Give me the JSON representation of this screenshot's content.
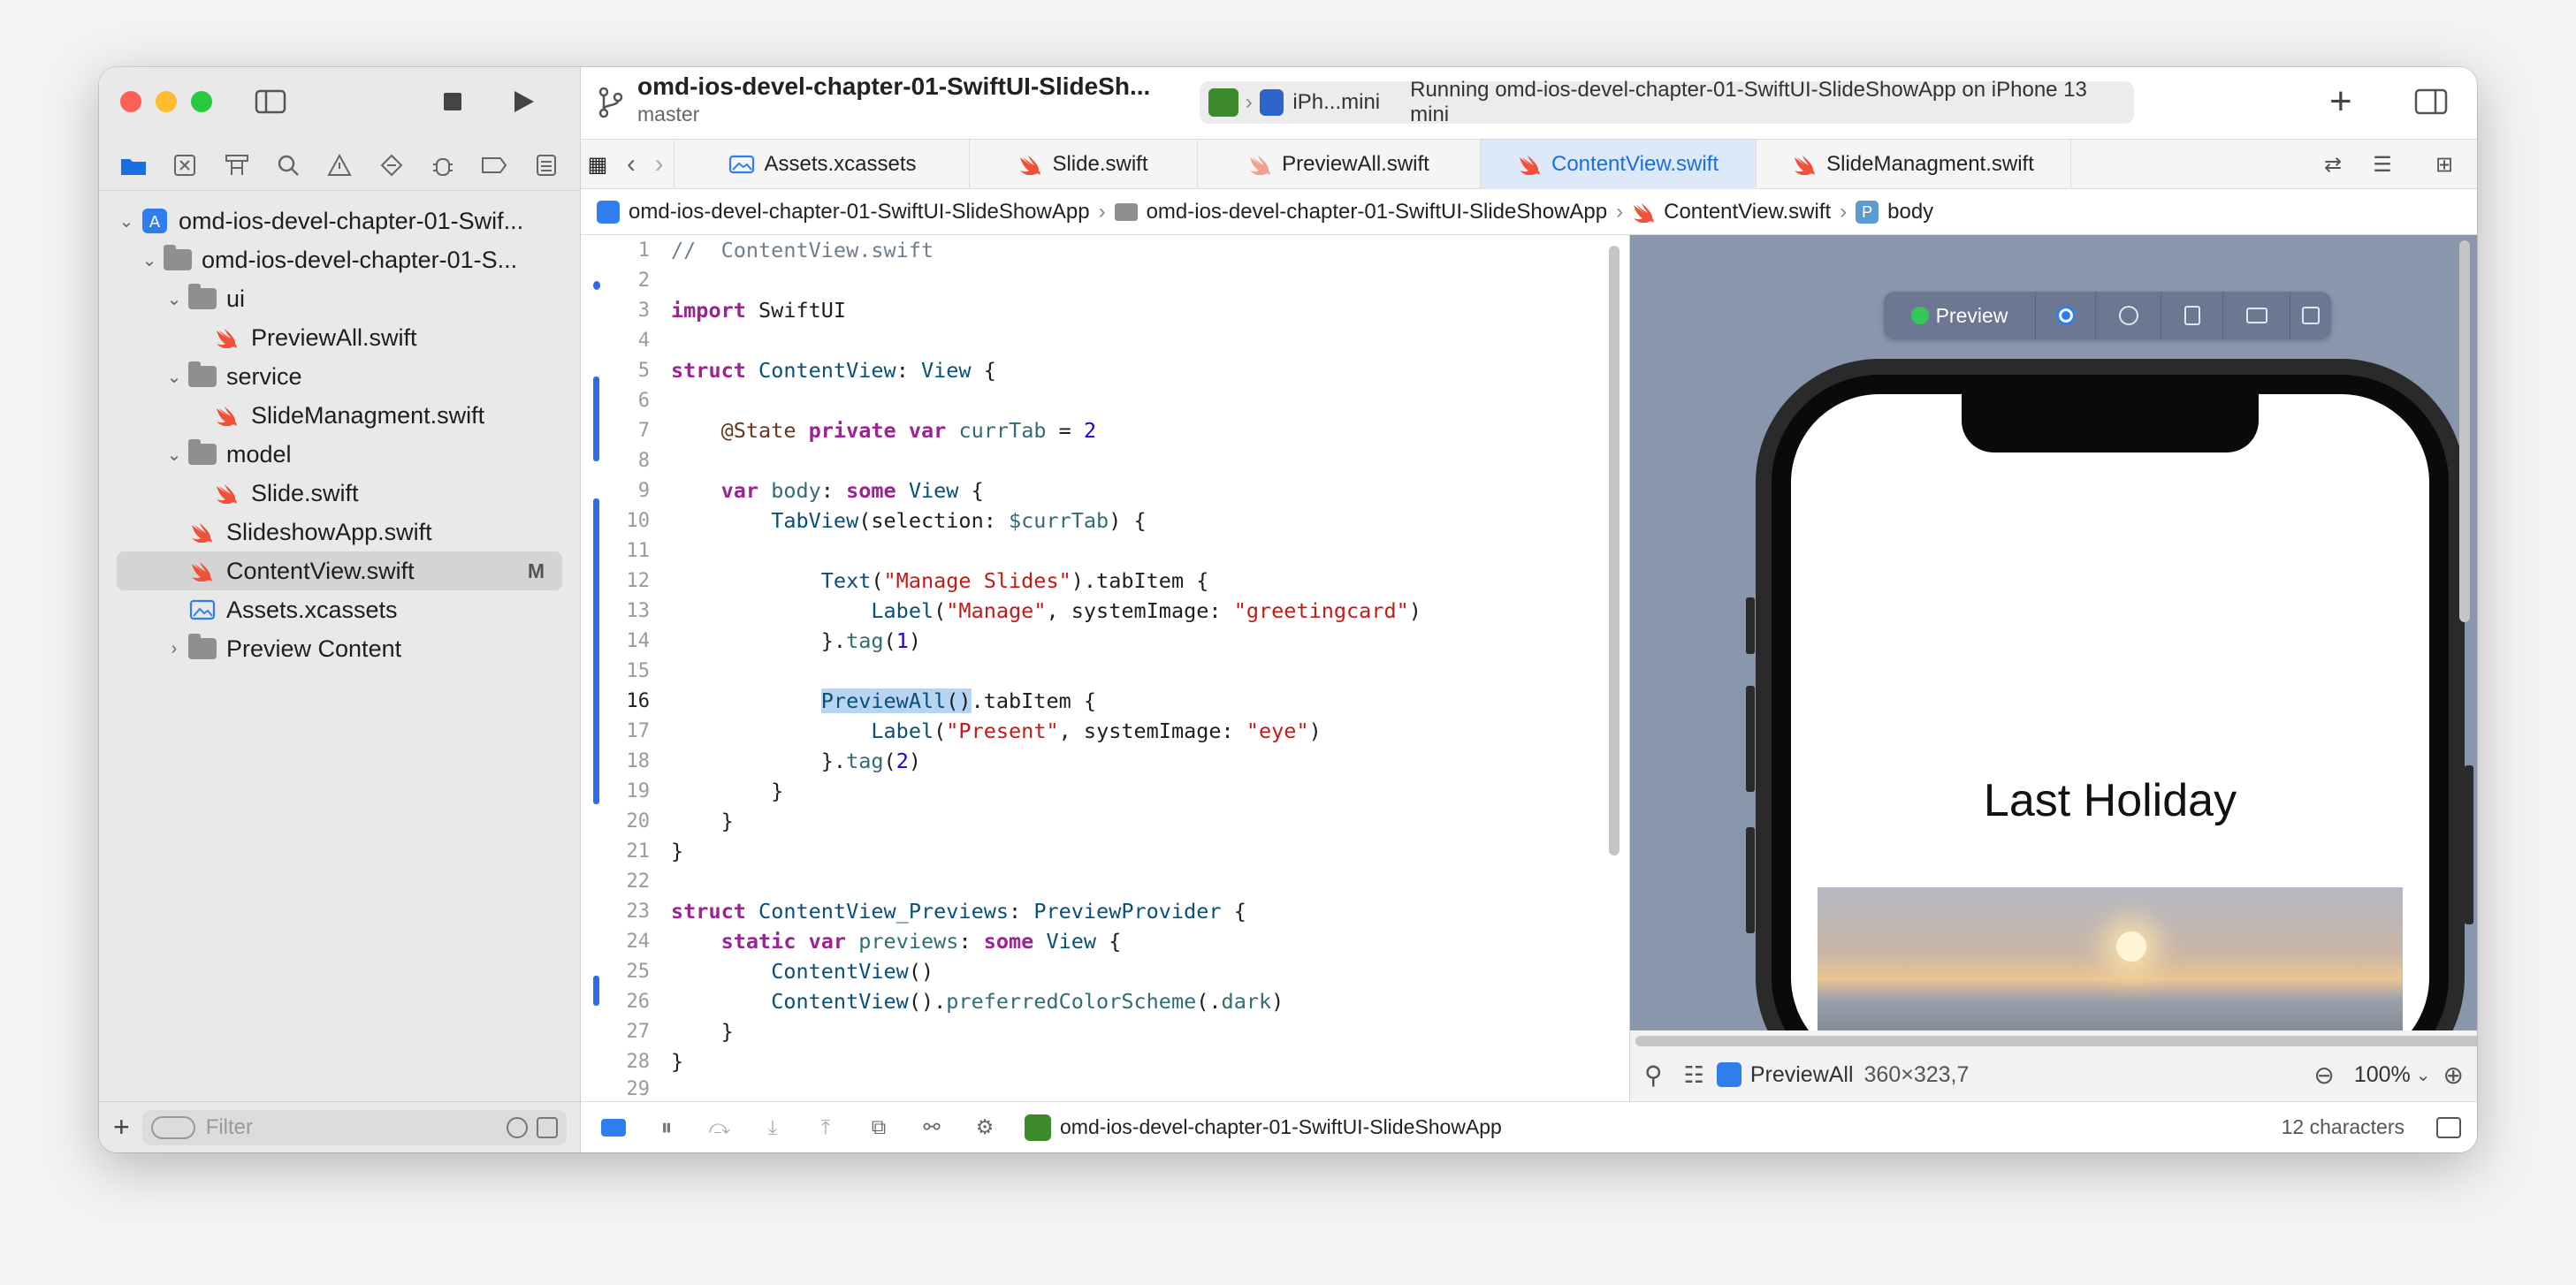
{
  "window": {
    "project_name": "omd-ios-devel-chapter-01-SwiftUI-SlideSh...",
    "branch": "master",
    "device_label": "iPh...mini",
    "status_text": "Running omd-ios-devel-chapter-01-SwiftUI-SlideShowApp on iPhone 13 mini"
  },
  "colors": {
    "accent": "#1a6fe0",
    "close": "#fe5f57",
    "minimize": "#febc2e",
    "zoom": "#28c840",
    "preview_canvas": "#8897ab"
  },
  "navigator": {
    "tabs": [
      "folder-icon",
      "x-square-icon",
      "hierarchy-icon",
      "search-icon",
      "warning-icon",
      "diamond-icon",
      "debug-icon",
      "label-icon",
      "report-icon"
    ],
    "items": [
      {
        "label": "omd-ios-devel-chapter-01-Swif...",
        "icon": "project-icon",
        "level": 0,
        "expanded": true
      },
      {
        "label": "omd-ios-devel-chapter-01-S...",
        "icon": "folder-icon",
        "level": 1,
        "expanded": true
      },
      {
        "label": "ui",
        "icon": "folder-icon",
        "level": 2,
        "expanded": true
      },
      {
        "label": "PreviewAll.swift",
        "icon": "swift-icon",
        "level": 3
      },
      {
        "label": "service",
        "icon": "folder-icon",
        "level": 2,
        "expanded": true
      },
      {
        "label": "SlideManagment.swift",
        "icon": "swift-icon",
        "level": 3
      },
      {
        "label": "model",
        "icon": "folder-icon",
        "level": 2,
        "expanded": true
      },
      {
        "label": "Slide.swift",
        "icon": "swift-icon",
        "level": 3
      },
      {
        "label": "SlideshowApp.swift",
        "icon": "swift-icon",
        "level": 2
      },
      {
        "label": "ContentView.swift",
        "icon": "swift-icon",
        "level": 2,
        "selected": true,
        "badge": "M"
      },
      {
        "label": "Assets.xcassets",
        "icon": "assets-icon",
        "level": 2
      },
      {
        "label": "Preview Content",
        "icon": "folder-icon",
        "level": 2,
        "expanded": false
      }
    ],
    "filter_placeholder": "Filter"
  },
  "tabs": [
    {
      "label": "Assets.xcassets",
      "icon": "assets-icon"
    },
    {
      "label": "Slide.swift",
      "icon": "swift-icon"
    },
    {
      "label": "PreviewAll.swift",
      "icon": "swift-icon"
    },
    {
      "label": "ContentView.swift",
      "icon": "swift-icon",
      "active": true
    },
    {
      "label": "SlideManagment.swift",
      "icon": "swift-icon"
    }
  ],
  "breadcrumb": [
    "omd-ios-devel-chapter-01-SwiftUI-SlideShowApp",
    "omd-ios-devel-chapter-01-SwiftUI-SlideShowApp",
    "ContentView.swift",
    "body"
  ],
  "editor": {
    "current_line": 16,
    "lines": [
      "//  ContentView.swift",
      "",
      "import SwiftUI",
      "",
      "struct ContentView: View {",
      "",
      "    @State private var currTab = 2",
      "",
      "    var body: some View {",
      "        TabView(selection: $currTab) {",
      "",
      "            Text(\"Manage Slides\").tabItem {",
      "                Label(\"Manage\", systemImage: \"greetingcard\")",
      "            }.tag(1)",
      "",
      "            PreviewAll().tabItem {",
      "                Label(\"Present\", systemImage: \"eye\")",
      "            }.tag(2)",
      "        }",
      "    }",
      "}",
      "",
      "struct ContentView_Previews: PreviewProvider {",
      "    static var previews: some View {",
      "        ContentView()",
      "        ContentView().preferredColorScheme(.dark)",
      "    }",
      "}",
      ""
    ]
  },
  "preview": {
    "button_label": "Preview",
    "slide_title": "Last Holiday",
    "view_name": "PreviewAll",
    "size_label": "360×323,7",
    "zoom": "100%"
  },
  "bottom_bar": {
    "scheme": "omd-ios-devel-chapter-01-SwiftUI-SlideShowApp",
    "selection_info": "12 characters"
  }
}
